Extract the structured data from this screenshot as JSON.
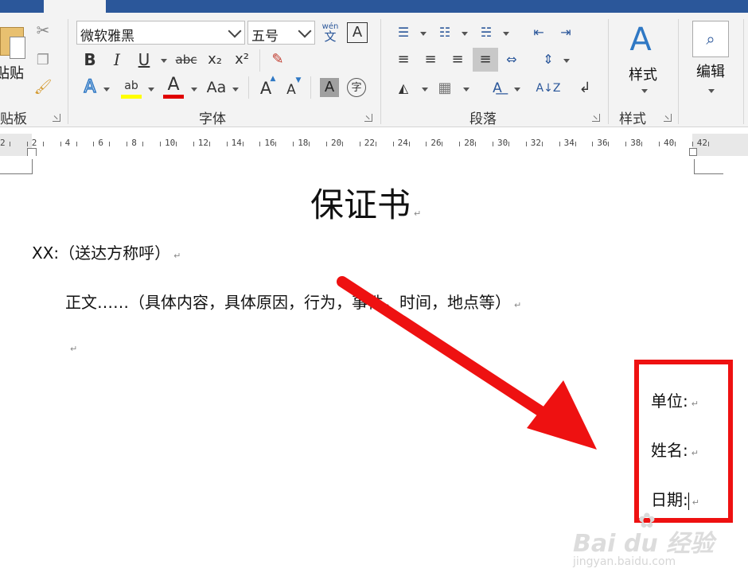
{
  "ribbon": {
    "clipboard": {
      "paste_label": "贴贴",
      "group_label": "贴板"
    },
    "font": {
      "font_name": "微软雅黑",
      "font_size": "五号",
      "wen_top": "wén",
      "wen_bottom": "文",
      "border_char": "A",
      "bold": "B",
      "italic": "I",
      "underline": "U",
      "strike": "abc",
      "subscript": "x₂",
      "superscript": "x²",
      "text_effect": "A",
      "highlight_label": "ab",
      "font_color_char": "A",
      "change_case": "Aa",
      "grow_font": "A",
      "shrink_font": "A",
      "char_shading": "A",
      "enclose_char": "字",
      "group_label": "字体",
      "highlight_color": "#ffff00",
      "font_color": "#e00000"
    },
    "paragraph": {
      "group_label": "段落"
    },
    "styles": {
      "label": "样式",
      "group_label": "样式"
    },
    "editing": {
      "label": "编辑"
    }
  },
  "ruler": {
    "numbers": [
      "2",
      "2",
      "4",
      "6",
      "8",
      "10",
      "12",
      "14",
      "16",
      "18",
      "20",
      "22",
      "24",
      "26",
      "28",
      "30",
      "32",
      "34",
      "36",
      "38",
      "40",
      "42"
    ]
  },
  "document": {
    "title": "保证书",
    "salutation": "XX:（送达方称呼）",
    "body": "正文……（具体内容，具体原因，行为，事件，时间，地点等）",
    "signature": {
      "unit": "单位:",
      "name": "姓名:",
      "date": "日期:"
    },
    "paragraph_mark": "↵"
  },
  "overlay": {
    "arrow_color": "#ee1111",
    "box_color": "#ee1111"
  },
  "watermark": {
    "brand": "Bai du 经验",
    "url": "jingyan.baidu.com"
  }
}
